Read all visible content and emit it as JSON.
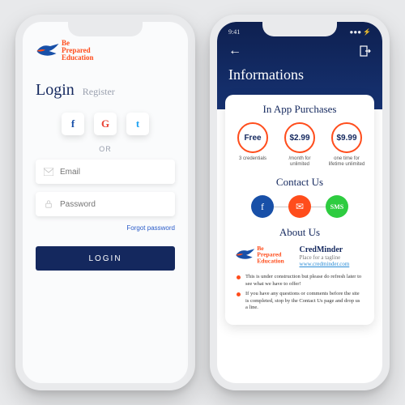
{
  "brand": {
    "line1": "Be",
    "line2": "Prepared",
    "line3": "Education"
  },
  "left": {
    "tabs": {
      "login": "Login",
      "register": "Register"
    },
    "or": "OR",
    "email_ph": "Email",
    "password_ph": "Password",
    "forgot": "Forgot password",
    "login_btn": "LOGIN",
    "social": {
      "fb": "f",
      "gg": "G",
      "tw": "t"
    }
  },
  "right": {
    "status_time": "9:41",
    "title": "Informations",
    "purchases_title": "In App Purchases",
    "plans": [
      {
        "price": "Free",
        "desc": "3 credentials"
      },
      {
        "price": "$2.99",
        "desc": "/month for unlimited"
      },
      {
        "price": "$9.99",
        "desc": "one time for lifetime unlimited"
      }
    ],
    "contact_title": "Contact Us",
    "contact": {
      "fb": "f",
      "mail": "✉",
      "sms": "SMS"
    },
    "about_title": "About Us",
    "about": {
      "name": "CredMinder",
      "tag": "Place for a tagline",
      "link": "www.credminder.com"
    },
    "bullets": [
      "This is under construction but please do refresh later to see what we have to offer!",
      "If you have any questions or comments before the site is completed, stop by the Contact Us page and drop us a line."
    ]
  }
}
